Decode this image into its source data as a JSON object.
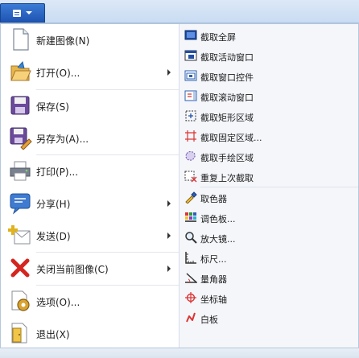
{
  "app_button": {
    "icon": "app-menu-icon",
    "caret": "chevron-down-icon"
  },
  "left_menu": [
    {
      "label": "新建图像(N)",
      "icon": "new-image-icon",
      "submenu": false
    },
    {
      "label": "打开(O)...",
      "icon": "open-folder-icon",
      "submenu": true
    },
    {
      "label": "保存(S)",
      "icon": "save-icon",
      "submenu": false
    },
    {
      "label": "另存为(A)...",
      "icon": "save-as-icon",
      "submenu": false
    },
    {
      "label": "打印(P)...",
      "icon": "print-icon",
      "submenu": false
    },
    {
      "label": "分享(H)",
      "icon": "share-icon",
      "submenu": true
    },
    {
      "label": "发送(D)",
      "icon": "send-icon",
      "submenu": true
    },
    {
      "label": "关闭当前图像(C)",
      "icon": "close-icon",
      "submenu": true
    },
    {
      "label": "选项(O)...",
      "icon": "options-gear-icon",
      "submenu": false
    },
    {
      "label": "退出(X)",
      "icon": "exit-icon",
      "submenu": false
    }
  ],
  "right_menu": {
    "capture": [
      {
        "label": "截取全屏",
        "icon": "fullscreen-capture-icon"
      },
      {
        "label": "截取活动窗口",
        "icon": "active-window-capture-icon"
      },
      {
        "label": "截取窗口控件",
        "icon": "window-control-capture-icon"
      },
      {
        "label": "截取滚动窗口",
        "icon": "scroll-window-capture-icon"
      },
      {
        "label": "截取矩形区域",
        "icon": "rectangle-capture-icon"
      },
      {
        "label": "截取固定区域...",
        "icon": "fixed-region-capture-icon"
      },
      {
        "label": "截取手绘区域",
        "icon": "freehand-capture-icon"
      },
      {
        "label": "重复上次截取",
        "icon": "repeat-capture-icon"
      }
    ],
    "tools": [
      {
        "label": "取色器",
        "icon": "color-picker-icon"
      },
      {
        "label": "调色板...",
        "icon": "palette-icon"
      },
      {
        "label": "放大镜...",
        "icon": "magnifier-icon"
      },
      {
        "label": "标尺...",
        "icon": "ruler-icon"
      },
      {
        "label": "量角器",
        "icon": "protractor-icon"
      },
      {
        "label": "坐标轴",
        "icon": "crosshair-icon"
      },
      {
        "label": "白板",
        "icon": "whiteboard-icon"
      }
    ]
  }
}
